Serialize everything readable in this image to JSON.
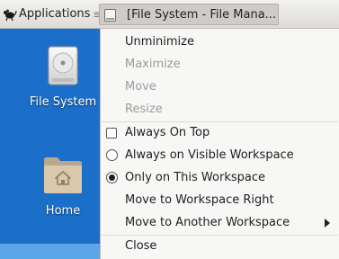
{
  "panel": {
    "applications_label": "Applications",
    "applications_separator": "≡",
    "taskbar_window_label": "[File System - File Mana..."
  },
  "desktop": {
    "icons": [
      {
        "label": "File System",
        "icon": "drive-icon"
      },
      {
        "label": "Home",
        "icon": "home-folder-icon"
      }
    ]
  },
  "context_menu": {
    "items": [
      {
        "label": "Unminimize",
        "enabled": true
      },
      {
        "label": "Maximize",
        "enabled": false
      },
      {
        "label": "Move",
        "enabled": false
      },
      {
        "label": "Resize",
        "enabled": false
      },
      {
        "label": "Always On Top",
        "enabled": true,
        "control": "checkbox",
        "checked": false
      },
      {
        "label": "Always on Visible Workspace",
        "enabled": true,
        "control": "radio",
        "checked": false
      },
      {
        "label": "Only on This Workspace",
        "enabled": true,
        "control": "radio",
        "checked": true
      },
      {
        "label": "Move to Workspace Right",
        "enabled": true
      },
      {
        "label": "Move to Another Workspace",
        "enabled": true,
        "submenu": true
      },
      {
        "label": "Close",
        "enabled": true
      }
    ]
  },
  "colors": {
    "desktop_background": "#1c6fc9",
    "menu_background": "#f7f7f6",
    "disabled_text": "#9b9b9b"
  }
}
